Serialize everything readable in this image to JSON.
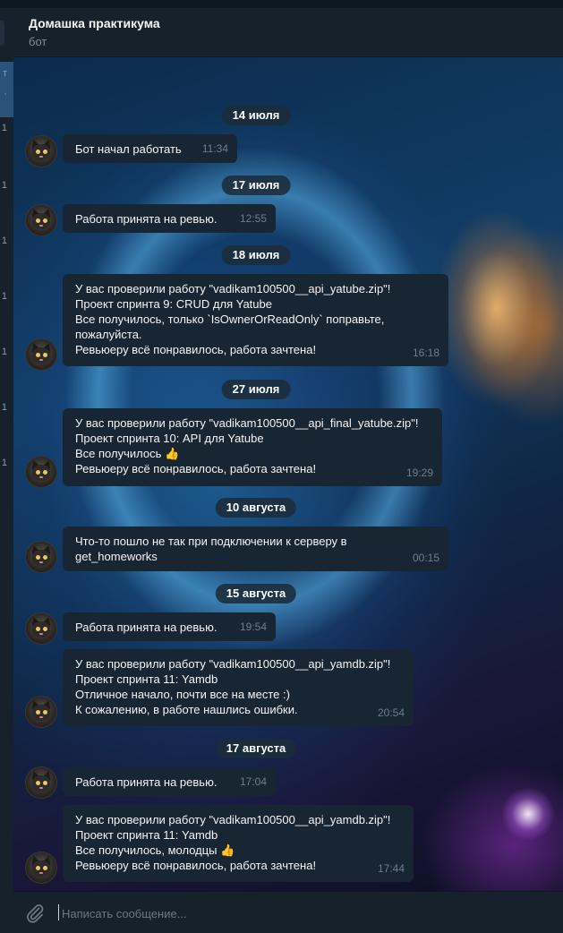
{
  "header": {
    "title": "Домашка практикума",
    "subtitle": "бот"
  },
  "sidebar": {
    "marks": [
      "т",
      "·",
      "1",
      "1",
      "1",
      "1",
      "1",
      "1",
      "1"
    ]
  },
  "dates": [
    "14 июля",
    "17 июля",
    "18 июля",
    "27 июля",
    "10 августа",
    "15 августа",
    "17 августа"
  ],
  "messages": [
    {
      "lines": [
        "Бот начал работать"
      ],
      "time": "11:34"
    },
    {
      "lines": [
        "Работа принята на ревью."
      ],
      "time": "12:55"
    },
    {
      "lines": [
        "У вас проверили работу \"vadikam100500__api_yatube.zip\"!",
        "Проект спринта 9: CRUD для Yatube",
        "Все получилось, только `IsOwnerOrReadOnly` поправьте,",
        "пожалуйста.",
        "Ревьюеру всё понравилось, работа зачтена!"
      ],
      "time": "16:18"
    },
    {
      "lines": [
        "У вас проверили работу \"vadikam100500__api_final_yatube.zip\"!",
        "Проект спринта 10: API для Yatube",
        "Все получилось 👍",
        "Ревьюеру всё понравилось, работа зачтена!"
      ],
      "time": "19:29"
    },
    {
      "lines": [
        "Что-то пошло не так при подключении к серверу в",
        "get_homeworks"
      ],
      "time": "00:15"
    },
    {
      "lines": [
        "Работа принята на ревью."
      ],
      "time": "19:54"
    },
    {
      "lines": [
        "У вас проверили работу \"vadikam100500__api_yamdb.zip\"!",
        "Проект спринта 11: Yamdb",
        "Отличное начало, почти все на месте :)",
        "К сожалению, в работе нашлись ошибки."
      ],
      "time": "20:54"
    },
    {
      "lines": [
        "Работа принята на ревью."
      ],
      "time": "17:04"
    },
    {
      "lines": [
        "У вас проверили работу \"vadikam100500__api_yamdb.zip\"!",
        "Проект спринта 11: Yamdb",
        "Все получилось, молодцы 👍",
        "Ревьюеру всё понравилось, работа зачтена!"
      ],
      "time": "17:44"
    }
  ],
  "composer": {
    "placeholder": "Написать сообщение..."
  },
  "icons": {
    "attach": "paperclip-icon",
    "avatar": "bot-avatar-cat"
  },
  "colors": {
    "bubble": "#182533",
    "header": "#17212b",
    "date_pill": "#1b2c3a",
    "time_text": "#6d7f8f",
    "active_chat": "#2b5278"
  }
}
